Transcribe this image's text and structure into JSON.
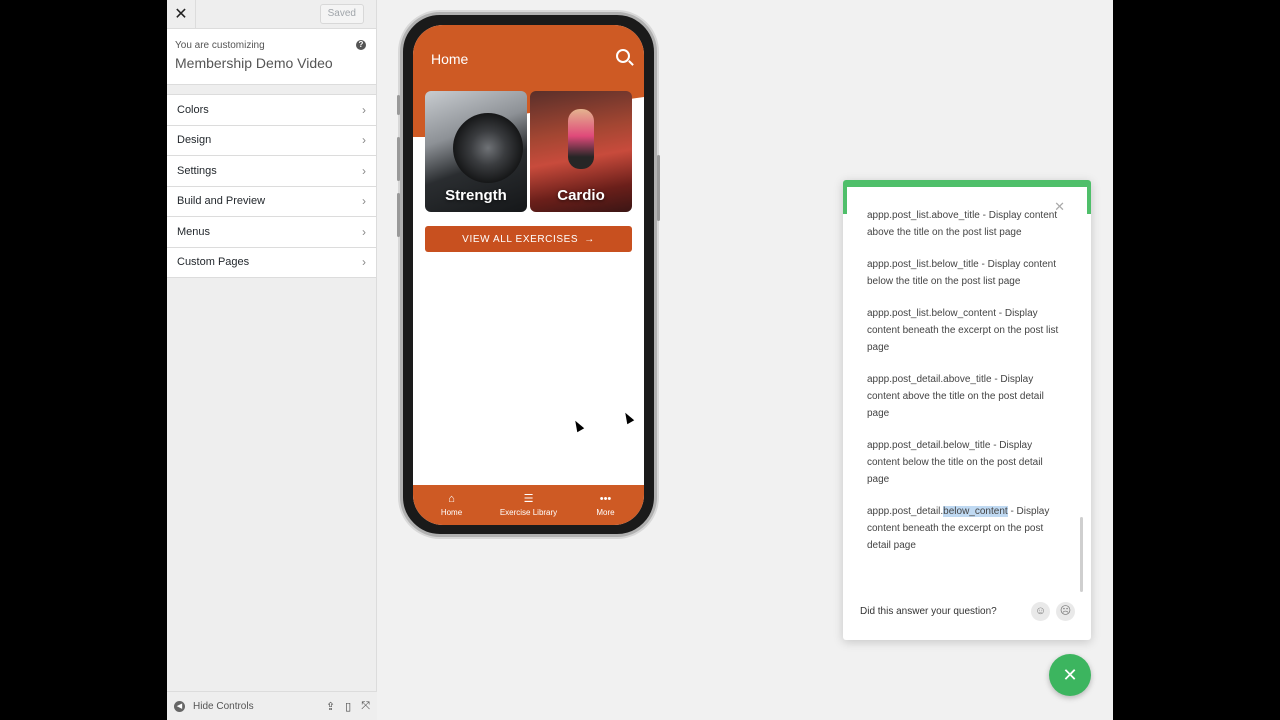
{
  "sidebar": {
    "close_label": "✕",
    "saved_label": "Saved",
    "customizing_label": "You are customizing",
    "site_name": "Membership Demo Video",
    "help_label": "?",
    "items": [
      {
        "label": "Colors"
      },
      {
        "label": "Design"
      },
      {
        "label": "Settings"
      },
      {
        "label": "Build and Preview"
      },
      {
        "label": "Menus"
      },
      {
        "label": "Custom Pages"
      }
    ],
    "hide_controls_label": "Hide Controls"
  },
  "phone": {
    "title": "Home",
    "cards": [
      {
        "label": "Strength"
      },
      {
        "label": "Cardio"
      }
    ],
    "view_all_label": "VIEW ALL EXERCISES",
    "tabs": [
      {
        "icon": "⌂",
        "label": "Home"
      },
      {
        "icon": "☰",
        "label": "Exercise Library"
      },
      {
        "icon": "•••",
        "label": "More"
      }
    ]
  },
  "help_panel": {
    "entries": [
      {
        "text": "appp.post_list.above_title - Display content above the title on the post list page"
      },
      {
        "text": "appp.post_list.below_title - Display content below the title on the post list page"
      },
      {
        "text": "appp.post_list.below_content - Display content beneath the excerpt on the post list page"
      },
      {
        "text": "appp.post_detail.above_title - Display content above the title on the post detail page"
      },
      {
        "text": "appp.post_detail.below_title - Display content below the title on the post detail page"
      }
    ],
    "last_entry_prefix": "appp.post_detail.",
    "last_entry_highlight": "below_content",
    "last_entry_suffix": " - Display content beneath the excerpt on the post detail page",
    "question_label": "Did this answer your question?"
  },
  "colors": {
    "brand_orange": "#ce5a24",
    "help_green": "#4fbf6a"
  }
}
